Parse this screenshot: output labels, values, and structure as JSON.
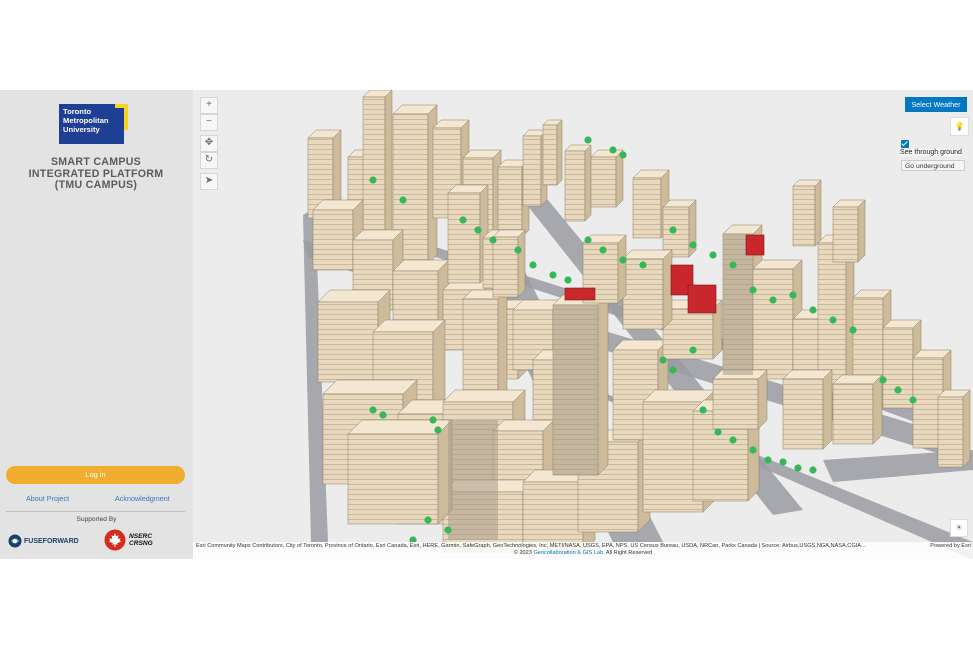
{
  "sidebar": {
    "logo_text": "Toronto\nMetropolitan\nUniversity",
    "title": "SMART CAMPUS\nINTEGRATED PLATFORM\n(TMU CAMPUS)",
    "login_label": "Log in",
    "about_label": "About Project",
    "ack_label": "Acknowledgment",
    "supported_label": "Supported By",
    "sponsor1": "FUSEFORWARD",
    "sponsor2": "NSERC\nCRSNG"
  },
  "map": {
    "zoom_in_icon": "plus-icon",
    "zoom_out_icon": "minus-icon",
    "pan_icon": "move-icon",
    "rotate_icon": "rotate-icon",
    "compass_icon": "compass-icon",
    "weather_button": "Select Weather",
    "daylight_icon": "lightbulb-icon",
    "see_through_label": "See through ground",
    "see_through_checked": true,
    "underground_button": "Go underground",
    "lighting_icon": "sun-icon",
    "attribution": "Esri Community Maps Contributors, City of Toronto, Province of Ontario, Esri Canada, Esri, HERE, Garmin, SafeGraph, GeoTechnologies, Inc, METI/NASA, USGS, EPA, NPS, US Census Bureau, USDA, NRCan, Parks Canada | Source: Airbus,USGS,NGA,NASA,CGIA...",
    "copyright_prefix": "© 2023",
    "copyright_lab": "Geocollaboration & GIS Lab",
    "copyright_suffix": ". All Right Reserved",
    "powered_by": "Powered by Esri",
    "colors": {
      "building": "#e8d8bd",
      "road": "#9a9ca2",
      "tree": "#35b85a",
      "highlight": "#c8282b",
      "accent": "#0079c1"
    }
  }
}
